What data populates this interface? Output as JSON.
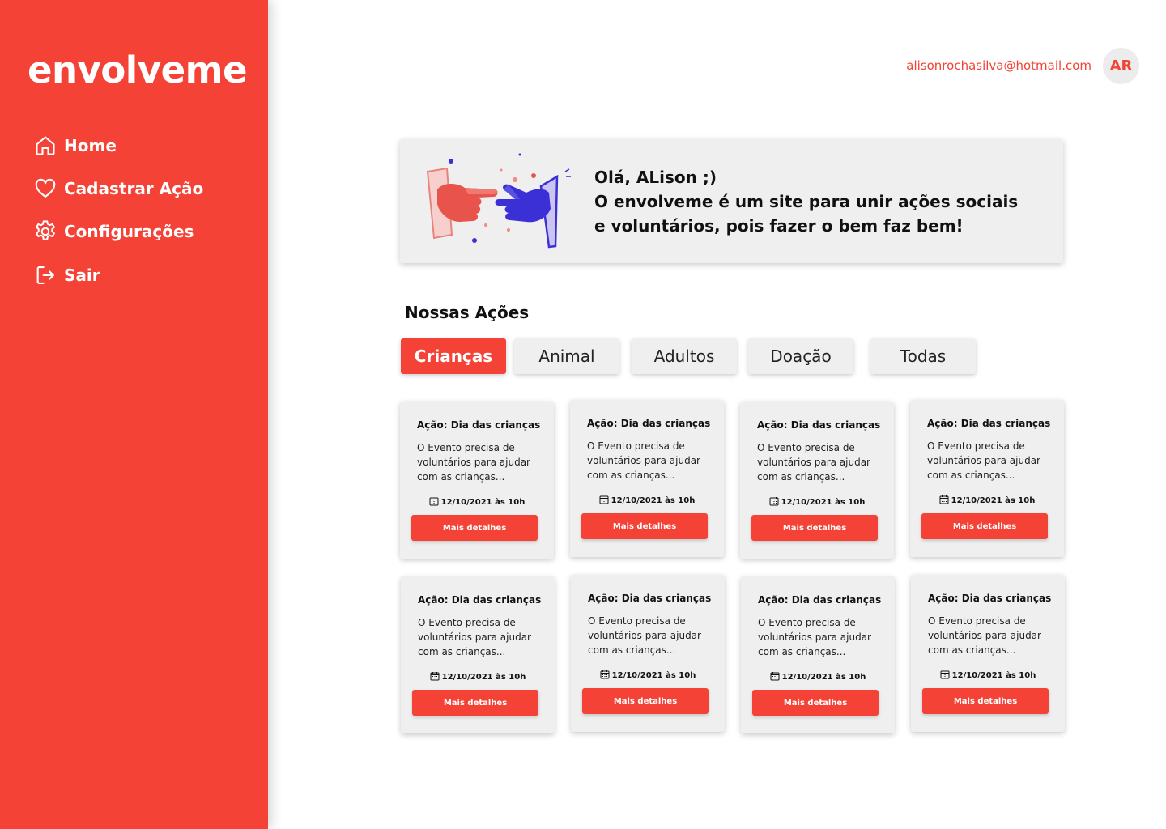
{
  "app": {
    "logo": "envolveme"
  },
  "sidebar": {
    "items": [
      {
        "label": "Home",
        "icon": "home-icon"
      },
      {
        "label": "Cadastrar Ação",
        "icon": "heart-icon"
      },
      {
        "label": "Configurações",
        "icon": "gear-icon"
      },
      {
        "label": "Sair",
        "icon": "logout-icon"
      }
    ]
  },
  "header": {
    "email": "alisonrochasilva@hotmail.com",
    "avatar_initials": "AR"
  },
  "banner": {
    "greeting": "Olá, ALison ;)",
    "line1": "O envolveme é um site para unir ações sociais",
    "line2": "e voluntários, pois fazer o bem faz bem!"
  },
  "actions": {
    "title": "Nossas Ações",
    "tabs": [
      "Crianças",
      "Animal",
      "Adultos",
      "Doação",
      "Todas"
    ],
    "active_tab": "Crianças",
    "cards": [
      {
        "title": "Ação: Dia das crianças",
        "desc": "O Evento precisa de voluntários para ajudar com as crianças...",
        "date": "12/10/2021 às 10h",
        "button": "Mais detalhes"
      },
      {
        "title": "Ação: Dia das crianças",
        "desc": "O Evento precisa de voluntários para ajudar com as crianças...",
        "date": "12/10/2021 às 10h",
        "button": "Mais detalhes"
      },
      {
        "title": "Ação: Dia das crianças",
        "desc": "O Evento precisa de voluntários para ajudar com as crianças...",
        "date": "12/10/2021 às 10h",
        "button": "Mais detalhes"
      },
      {
        "title": "Ação: Dia das crianças",
        "desc": "O Evento precisa de voluntários para ajudar com as crianças...",
        "date": "12/10/2021 às 10h",
        "button": "Mais detalhes"
      },
      {
        "title": "Ação: Dia das crianças",
        "desc": "O Evento precisa de voluntários para ajudar com as crianças...",
        "date": "12/10/2021 às 10h",
        "button": "Mais detalhes"
      },
      {
        "title": "Ação: Dia das crianças",
        "desc": "O Evento precisa de voluntários para ajudar com as crianças...",
        "date": "12/10/2021 às 10h",
        "button": "Mais detalhes"
      },
      {
        "title": "Ação: Dia das crianças",
        "desc": "O Evento precisa de voluntários para ajudar com as crianças...",
        "date": "12/10/2021 às 10h",
        "button": "Mais detalhes"
      },
      {
        "title": "Ação: Dia das crianças",
        "desc": "O Evento precisa de voluntários para ajudar com as crianças...",
        "date": "12/10/2021 às 10h",
        "button": "Mais detalhes"
      }
    ]
  },
  "colors": {
    "accent": "#f44336",
    "card_bg": "#efefef",
    "text": "#111111",
    "illustration_blue": "#3b2fd6"
  }
}
